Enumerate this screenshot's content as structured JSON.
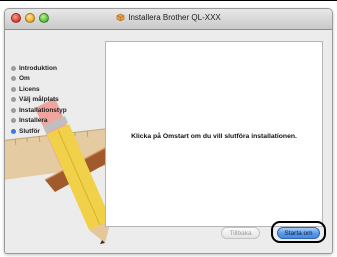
{
  "window": {
    "title": "Installera Brother QL-XXX",
    "title_icon": "package-icon"
  },
  "sidebar": {
    "items": [
      {
        "label": "Introduktion",
        "state": "done"
      },
      {
        "label": "Om",
        "state": "done"
      },
      {
        "label": "Licens",
        "state": "done"
      },
      {
        "label": "Välj målplats",
        "state": "done"
      },
      {
        "label": "Installationstyp",
        "state": "done"
      },
      {
        "label": "Installera",
        "state": "done"
      },
      {
        "label": "Slutför",
        "state": "current"
      }
    ]
  },
  "main": {
    "message": "Klicka på Omstart om du vill slutföra installationen."
  },
  "buttons": {
    "back_label": "Tillbaka",
    "restart_label": "Starta om"
  },
  "colors": {
    "accent": "#3a7bd5",
    "step_done": "#9b9b9b"
  }
}
